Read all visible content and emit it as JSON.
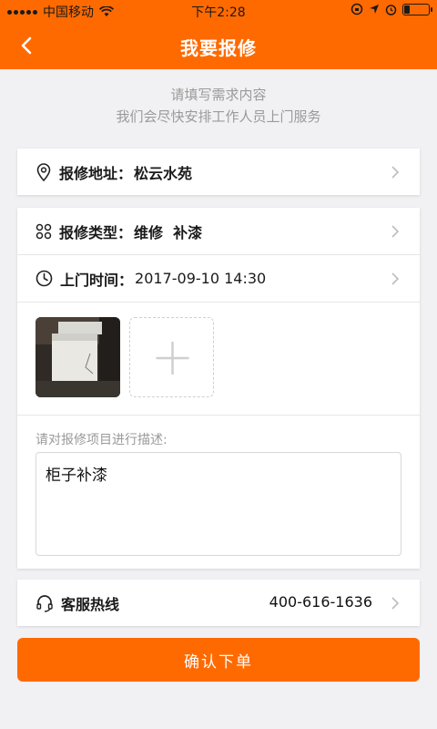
{
  "status_bar": {
    "carrier": "中国移动",
    "time": "下午2:28"
  },
  "nav": {
    "title": "我要报修",
    "back_icon": "chevron-left-icon"
  },
  "intro": {
    "line1": "请填写需求内容",
    "line2": "我们会尽快安排工作人员上门服务"
  },
  "address": {
    "label": "报修地址：",
    "value": "松云水苑"
  },
  "repair_type": {
    "label": "报修类型：",
    "value": "维修  补漆"
  },
  "visit_time": {
    "label": "上门时间：",
    "value": "2017-09-10 14:30"
  },
  "description": {
    "label": "请对报修项目进行描述:",
    "value": "柜子补漆"
  },
  "hotline": {
    "label": "客服热线",
    "number": "400-616-1636"
  },
  "confirm_button": {
    "label": "确认下单"
  },
  "colors": {
    "accent": "#ff6a00",
    "background": "#f1f1f3"
  }
}
